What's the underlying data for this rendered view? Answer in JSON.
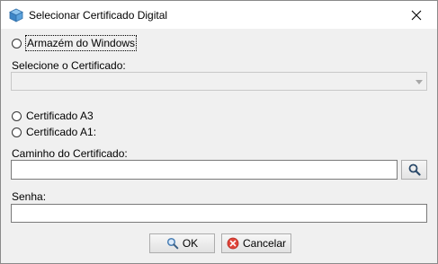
{
  "window": {
    "title": "Selecionar Certificado Digital",
    "icon": "cube-icon",
    "close_icon": "close-icon"
  },
  "options": {
    "windows_store": {
      "label": "Armazém do Windows",
      "selected": false
    },
    "a3": {
      "label": "Certificado A3",
      "selected": false
    },
    "a1": {
      "label": "Certificado A1:",
      "selected": false
    }
  },
  "certificate_select": {
    "label": "Selecione o Certificado:",
    "value": "",
    "enabled": false
  },
  "certificate_path": {
    "label": "Caminho do Certificado:",
    "value": "",
    "browse_icon": "search-icon"
  },
  "password": {
    "label": "Senha:",
    "value": ""
  },
  "buttons": {
    "ok": {
      "label": "OK",
      "icon": "search-icon"
    },
    "cancel": {
      "label": "Cancelar",
      "icon": "cancel-icon"
    }
  },
  "colors": {
    "dialog_background": "#f0f0f0",
    "titlebar_background": "#ffffff",
    "cancel_icon_red": "#e0453a"
  }
}
